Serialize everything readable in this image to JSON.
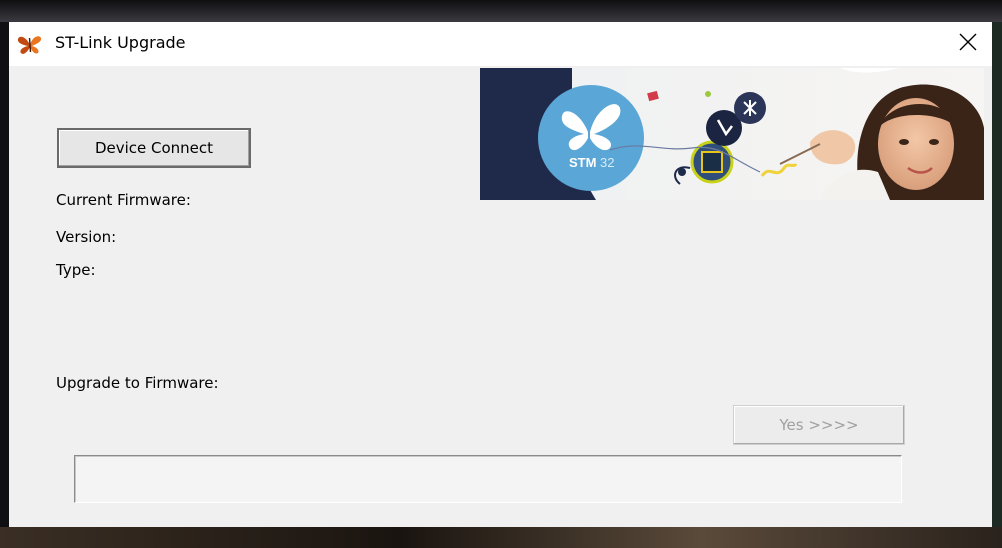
{
  "window": {
    "title": "ST-Link Upgrade",
    "icon": "butterfly-app-icon",
    "close_icon": "close-icon"
  },
  "main": {
    "connect_button_label": "Device Connect",
    "current_firmware_label": "Current Firmware:",
    "version_label": "Version:",
    "type_label": "Type:",
    "upgrade_label": "Upgrade to Firmware:",
    "yes_button_label": "Yes >>>>",
    "progress_fraction": 0
  },
  "banner": {
    "badge_text": "STM",
    "badge_text_suffix": "32"
  },
  "colors": {
    "banner_navy": "#1f2a4a",
    "badge_blue": "#5aa6d6",
    "window_bg": "#f0f0f0"
  }
}
